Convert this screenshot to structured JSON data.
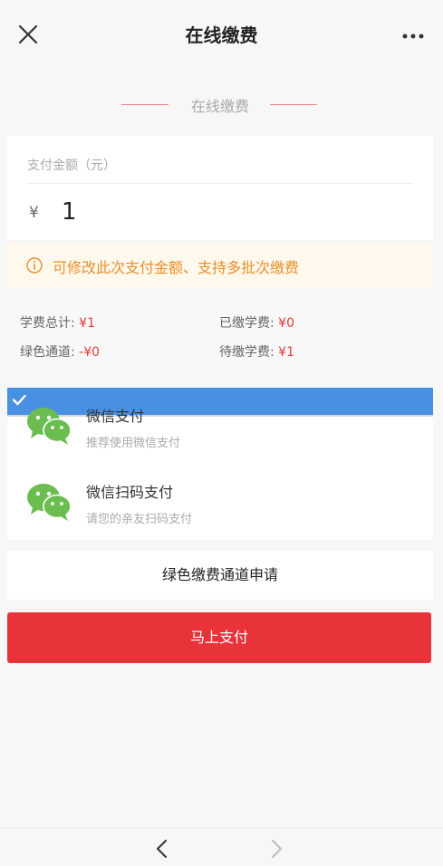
{
  "header": {
    "title": "在线缴费",
    "close_icon": "close-icon",
    "more_icon": "more-dots-icon"
  },
  "section": {
    "title": "在线缴费"
  },
  "amount": {
    "label": "支付金额（元）",
    "currency": "¥",
    "value": "1"
  },
  "notice": {
    "icon": "info-circle-icon",
    "text": "可修改此次支付金额、支持多批次缴费"
  },
  "fees": {
    "total_label": "学费总计:",
    "total_value": "¥1",
    "paid_label": "已缴学费:",
    "paid_value": "¥0",
    "green_label": "绿色通道:",
    "green_value": "-¥0",
    "pending_label": "待缴学费:",
    "pending_value": "¥1"
  },
  "payment_methods": [
    {
      "name": "微信支付",
      "desc": "推荐使用微信支付",
      "icon": "wechat-icon",
      "selected": true
    },
    {
      "name": "微信扫码支付",
      "desc": "请您的亲友扫码支付",
      "icon": "wechat-icon",
      "selected": false
    }
  ],
  "buttons": {
    "green_channel": "绿色缴费通道申请",
    "pay_now": "马上支付"
  },
  "colors": {
    "accent_red": "#e8333a",
    "wechat_green": "#6bbd4f",
    "check_blue": "#4a90e2",
    "notice_orange": "#e8902a"
  }
}
